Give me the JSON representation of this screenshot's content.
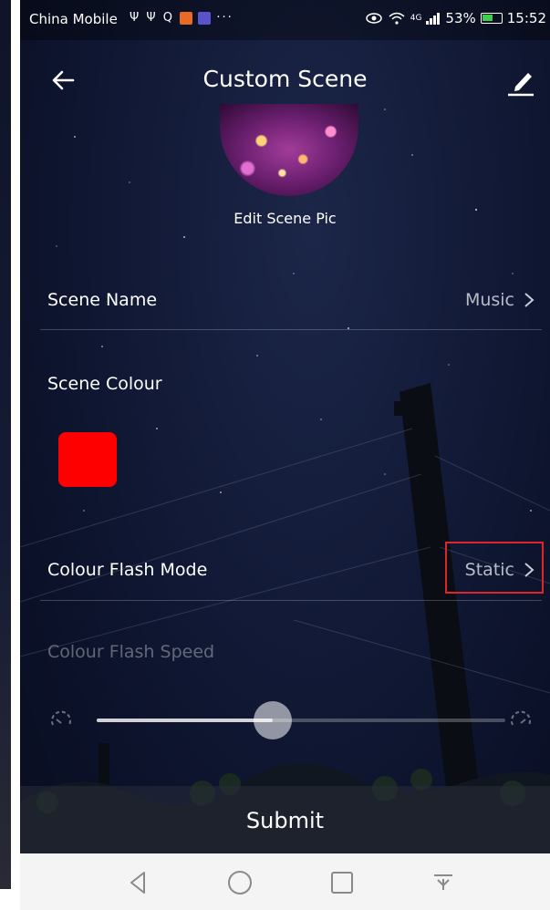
{
  "statusbar": {
    "carrier": "China Mobile",
    "icons_left": "Ψ Ψ Q",
    "network": "4G",
    "battery": "53%",
    "time": "15:52"
  },
  "appbar": {
    "back_icon": "arrow-left-icon",
    "title": "Custom Scene",
    "edit_icon": "pencil-icon"
  },
  "scene_pic": {
    "label": "Edit Scene Pic"
  },
  "scene_name": {
    "label": "Scene Name",
    "value": "Music"
  },
  "scene_colour": {
    "label": "Scene Colour",
    "color": "#ff0000"
  },
  "colour_flash_mode": {
    "label": "Colour Flash Mode",
    "value": "Static"
  },
  "colour_flash_speed": {
    "label": "Colour Flash Speed",
    "level_fraction": 0.43
  },
  "submit": {
    "label": "Submit"
  },
  "navbar": {
    "buttons": [
      "back-triangle-icon",
      "home-circle-icon",
      "recents-square-icon",
      "notification-pulldown-icon"
    ]
  },
  "colors": {
    "highlight": "#e0252a",
    "swatch": "#ff0000"
  }
}
